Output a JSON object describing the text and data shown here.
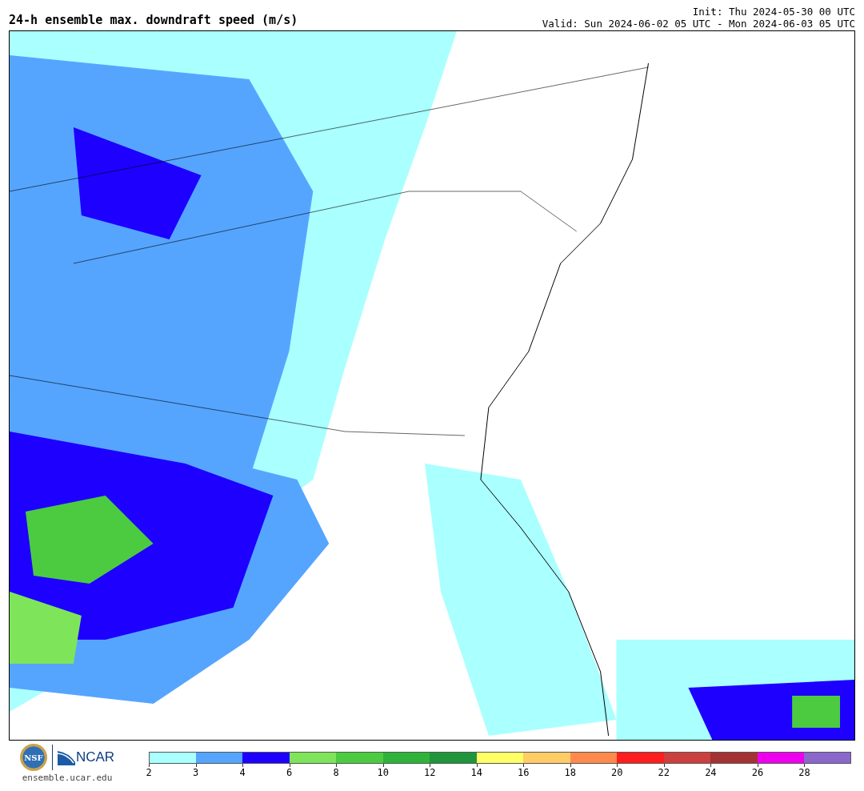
{
  "title": "24-h ensemble max. downdraft speed (m/s)",
  "init": "Init: Thu 2024-05-30 00 UTC",
  "valid": "Valid: Sun 2024-06-02 05 UTC - Mon 2024-06-03 05 UTC",
  "logos": {
    "nsf": "NSF",
    "ncar": "NCAR",
    "url": "ensemble.ucar.edu"
  },
  "legend": [
    {
      "color": "#aaffff",
      "label": "2"
    },
    {
      "color": "#55a5ff",
      "label": "3"
    },
    {
      "color": "#1e00ff",
      "label": "4"
    },
    {
      "color": "#7ee55a",
      "label": "6"
    },
    {
      "color": "#4ccb41",
      "label": "8"
    },
    {
      "color": "#2fb33a",
      "label": "10"
    },
    {
      "color": "#20963c",
      "label": "12"
    },
    {
      "color": "#ffff66",
      "label": "14"
    },
    {
      "color": "#ffcc66",
      "label": "16"
    },
    {
      "color": "#ff8a4c",
      "label": "18"
    },
    {
      "color": "#ff1e1e",
      "label": "20"
    },
    {
      "color": "#cc3f3f",
      "label": "22"
    },
    {
      "color": "#a53232",
      "label": "24"
    },
    {
      "color": "#ee00ee",
      "label": "26"
    },
    {
      "color": "#8a68cc",
      "label": "28"
    }
  ]
}
